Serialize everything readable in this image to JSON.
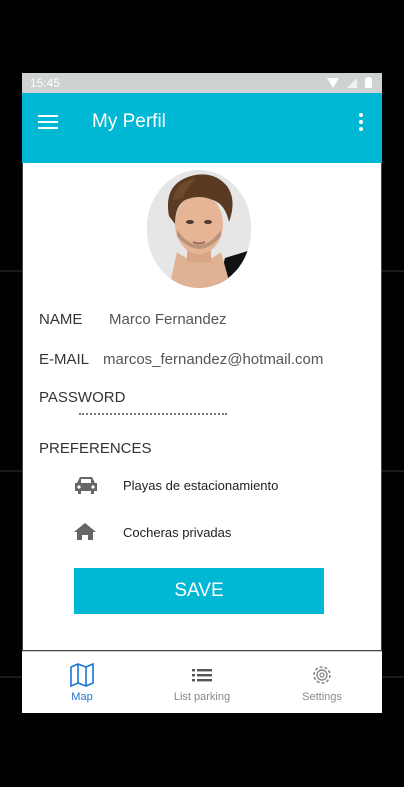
{
  "status_bar": {
    "time": "15:45",
    "icons": [
      "wifi-icon",
      "signal-icon",
      "battery-icon"
    ]
  },
  "app_bar": {
    "title": "My Perfil",
    "icons": [
      "menu-icon",
      "more-vert-icon"
    ]
  },
  "profile": {
    "name_label": "NAME",
    "name_value": "Marco Fernandez",
    "email_label": "E-MAIL",
    "email_value": "marcos_fernandez@hotmail.com",
    "password_label": "PASSWORD",
    "password_value": "••••••••••••••••",
    "preferences_label": "PREFERENCES",
    "preferences": [
      {
        "icon": "car-icon",
        "label": "Playas de estacionamiento"
      },
      {
        "icon": "home-icon",
        "label": "Cocheras privadas"
      }
    ],
    "save_label": "SAVE"
  },
  "bottom_nav": {
    "items": [
      {
        "icon": "map-icon",
        "label": "Map",
        "active": true
      },
      {
        "icon": "list-icon",
        "label": "List parking",
        "active": false
      },
      {
        "icon": "gear-icon",
        "label": "Settings",
        "active": false
      }
    ]
  },
  "colors": {
    "accent": "#00b8d4",
    "active_nav": "#1976d2"
  }
}
